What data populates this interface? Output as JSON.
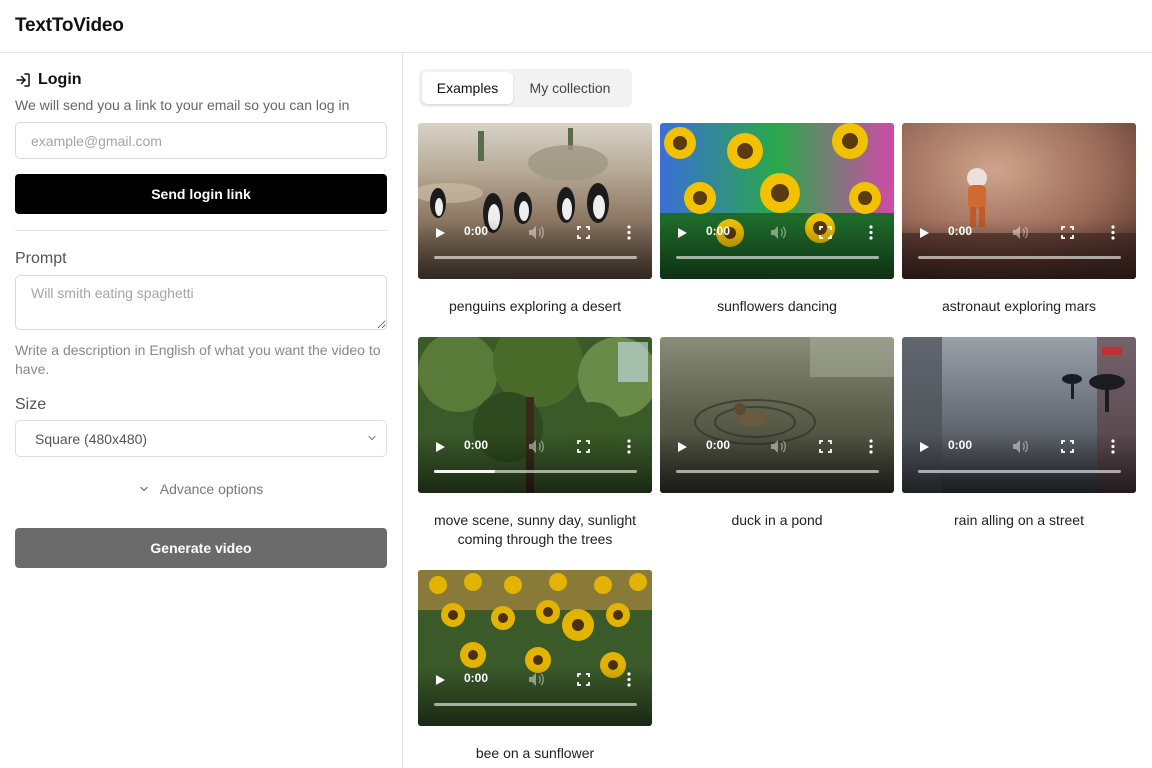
{
  "app": {
    "title": "TextToVideo"
  },
  "login": {
    "title": "Login",
    "subtitle": "We will send you a link to your email so you can log in",
    "email_placeholder": "example@gmail.com",
    "send_label": "Send login link"
  },
  "prompt": {
    "label": "Prompt",
    "placeholder": "Will smith eating spaghetti",
    "hint": "Write a description in English of what you want the video to have."
  },
  "size": {
    "label": "Size",
    "selected": "Square (480x480)"
  },
  "advance": {
    "label": "Advance options"
  },
  "generate": {
    "label": "Generate video"
  },
  "tabs": [
    {
      "label": "Examples",
      "active": true
    },
    {
      "label": "My collection",
      "active": false
    }
  ],
  "videos": [
    {
      "caption": "penguins exploring a desert",
      "time": "0:00",
      "progress": 0
    },
    {
      "caption": "sunflowers dancing",
      "time": "0:00",
      "progress": 0
    },
    {
      "caption": "astronaut exploring mars",
      "time": "0:00",
      "progress": 0
    },
    {
      "caption": "move scene, sunny day, sunlight coming through the trees",
      "time": "0:00",
      "progress": 0.3
    },
    {
      "caption": "duck in a pond",
      "time": "0:00",
      "progress": 0
    },
    {
      "caption": "rain alling on a street",
      "time": "0:00",
      "progress": 0
    },
    {
      "caption": "bee on a sunflower",
      "time": "0:00",
      "progress": 0
    }
  ]
}
